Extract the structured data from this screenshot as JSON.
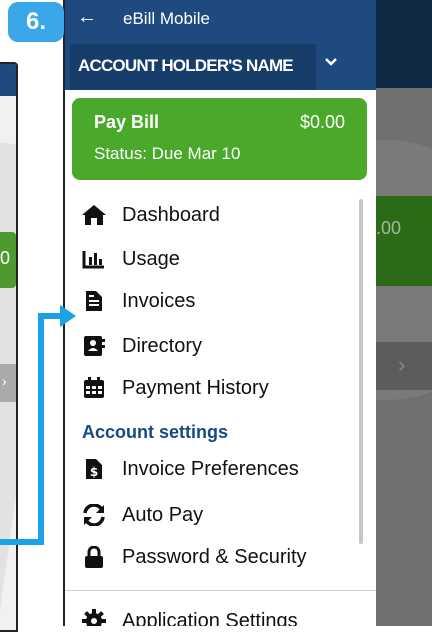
{
  "badge": {
    "label": "6."
  },
  "left_phone": {
    "green_text": "0",
    "chevron": "›"
  },
  "bg_app": {
    "amount_text": ".00",
    "chevron": "›"
  },
  "drawer": {
    "back_glyph": "←",
    "title": "eBill Mobile",
    "account": {
      "name": "ACCOUNT HOLDER'S NAME",
      "chevron": "⌄"
    },
    "pay_bill": {
      "label": "Pay Bill",
      "amount": "$0.00",
      "status": "Status: Due Mar 10"
    },
    "menu": [
      {
        "label": "Dashboard",
        "icon": "home-icon"
      },
      {
        "label": "Usage",
        "icon": "bar-chart-icon"
      },
      {
        "label": "Invoices",
        "icon": "document-icon"
      },
      {
        "label": "Directory",
        "icon": "address-book-icon"
      },
      {
        "label": "Payment History",
        "icon": "calendar-icon"
      }
    ],
    "section": {
      "title": "Account settings"
    },
    "settings_menu": [
      {
        "label": "Invoice Preferences",
        "icon": "invoice-dollar-icon"
      },
      {
        "label": "Auto Pay",
        "icon": "sync-icon"
      },
      {
        "label": "Password & Security",
        "icon": "lock-icon"
      }
    ],
    "bottom_item": {
      "label": "Application Settings",
      "icon": "gear-icon"
    }
  },
  "colors": {
    "header": "#1f4a80",
    "paybill": "#4aa82b",
    "accent": "#19a3e6",
    "section": "#174a85"
  }
}
